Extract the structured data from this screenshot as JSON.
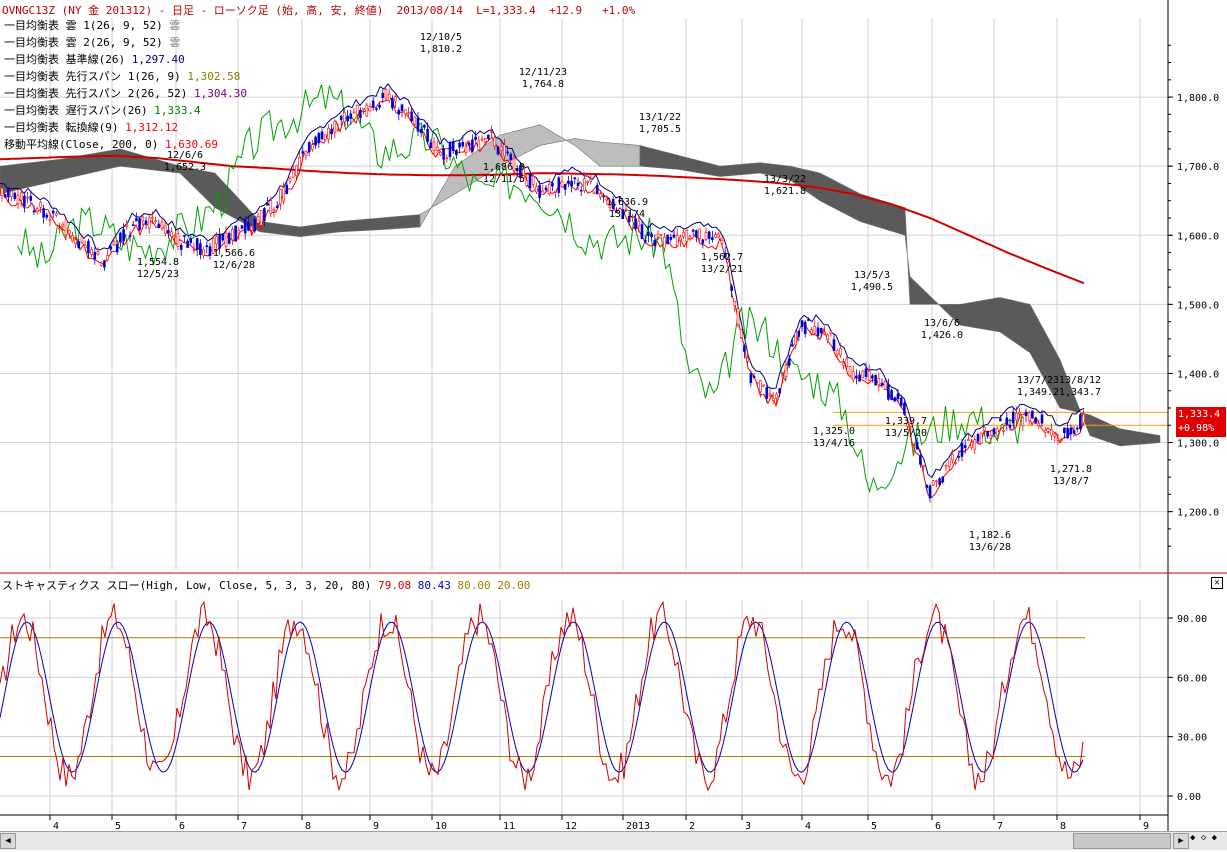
{
  "header": {
    "symbol_line": "OVNGC13Z (NY 金 201312) - 日足 - ローソク足 (始, 高, 安, 終値)  2013/08/14  L=1,333.4  +12.9   +1.0%"
  },
  "legend": [
    {
      "label": "一目均衡表 雲 1(26, 9, 52)",
      "value": "雲",
      "color": "#808080"
    },
    {
      "label": "一目均衡表 雲 2(26, 9, 52)",
      "value": "雲",
      "color": "#808080"
    },
    {
      "label": "一目均衡表 基準線(26)",
      "value": "1,297.40",
      "color": "#000080"
    },
    {
      "label": "一目均衡表 先行スパン 1(26, 9)",
      "value": "1,302.58",
      "color": "#808000"
    },
    {
      "label": "一目均衡表 先行スパン 2(26, 52)",
      "value": "1,304.30",
      "color": "#800080"
    },
    {
      "label": "一目均衡表 遅行スパン(26)",
      "value": "1,333.4",
      "color": "#008000"
    },
    {
      "label": "一目均衡表 転換線(9)",
      "value": "1,312.12",
      "color": "#ff0000"
    },
    {
      "label": "移動平均線(Close, 200, 0)",
      "value": "1,630.69",
      "color": "#ff0000"
    }
  ],
  "price_badge": {
    "price": "1,333.4",
    "change": "+0.98%"
  },
  "stochastic": {
    "title": "ストキャスティクス スロー(High, Low, Close, 5, 3, 3, 20, 80)",
    "v1": "79.08",
    "v2": "80.43",
    "v3": "80.00",
    "v4": "20.00",
    "close_label": "✕"
  },
  "scroll": {
    "left": "◀",
    "right": "▶",
    "zoom": "◆ ◇ ◆"
  },
  "colors": {
    "up_candle": "#ff0000",
    "down_candle": "#0000cc",
    "ma200": "#d00000",
    "kijun": "#000080",
    "tenkan": "#ff0000",
    "chikou": "#00a000",
    "cloud": "#606060",
    "cloud_light": "#c0c0c0",
    "hline": "#ff9900",
    "stoch_k": "#d00000",
    "stoch_d": "#0000c0",
    "stoch_band": "#a08000"
  },
  "chart_data": {
    "type": "line",
    "title": "OVNGC13Z (NY 金 201312) - 日足",
    "xlabel": "",
    "ylabel": "",
    "x_ticks": [
      "4",
      "5",
      "6",
      "7",
      "8",
      "9",
      "10",
      "11",
      "12",
      "2013",
      "2",
      "3",
      "4",
      "5",
      "6",
      "7",
      "8",
      "9"
    ],
    "y_ticks": [
      "1,800.0",
      "1,700.0",
      "1,600.0",
      "1,500.0",
      "1,400.0",
      "1,300.0",
      "1,200.0"
    ],
    "ylim": [
      1130,
      1900
    ],
    "annotations": [
      {
        "date": "12/10/5",
        "price": "1,810.2"
      },
      {
        "date": "12/11/23",
        "price": "1,764.8"
      },
      {
        "date": "13/1/22",
        "price": "1,705.5"
      },
      {
        "date": "12/6/6",
        "price": "1,652.3"
      },
      {
        "date": "12/11/5",
        "price": "1,686.0"
      },
      {
        "date": "13/1/4",
        "price": "1,636.9"
      },
      {
        "date": "13/3/22",
        "price": "1,621.8"
      },
      {
        "date": "12/5/23",
        "price": "1,554.8"
      },
      {
        "date": "12/6/28",
        "price": "1,566.6"
      },
      {
        "date": "13/2/21",
        "price": "1,562.7"
      },
      {
        "date": "13/5/3",
        "price": "1,490.5"
      },
      {
        "date": "13/6/6",
        "price": "1,426.0"
      },
      {
        "date": "13/7/23",
        "price": "1,349.2"
      },
      {
        "date": "13/8/12",
        "price": "1,343.7"
      },
      {
        "date": "13/4/16",
        "price": "1,325.0"
      },
      {
        "date": "13/5/20",
        "price": "1,339.7"
      },
      {
        "date": "13/8/7",
        "price": "1,271.8"
      },
      {
        "date": "13/6/28",
        "price": "1,182.6"
      }
    ],
    "series": [
      {
        "name": "移動平均線(Close, 200, 0)",
        "values": [
          1710,
          1712,
          1714,
          1715,
          1712,
          1706,
          1700,
          1697,
          1693,
          1690,
          1688,
          1687,
          1687,
          1688,
          1690,
          1689,
          1688,
          1686,
          1683,
          1680,
          1676,
          1670,
          1660,
          1645,
          1625,
          1600,
          1575,
          1552,
          1530
        ]
      },
      {
        "name": "close",
        "values": [
          1660,
          1650,
          1630,
          1595,
          1560,
          1610,
          1620,
          1590,
          1580,
          1600,
          1620,
          1660,
          1730,
          1760,
          1780,
          1800,
          1770,
          1720,
          1730,
          1740,
          1700,
          1660,
          1680,
          1670,
          1640,
          1600,
          1590,
          1600,
          1590,
          1400,
          1360,
          1470,
          1460,
          1400,
          1390,
          1350,
          1230,
          1280,
          1310,
          1330,
          1340,
          1310,
          1333
        ]
      }
    ],
    "stochastic": {
      "ylim": [
        0,
        100
      ],
      "y_ticks": [
        "90.00",
        "60.00",
        "30.00",
        "0.00"
      ],
      "bands": [
        80,
        20
      ]
    }
  }
}
